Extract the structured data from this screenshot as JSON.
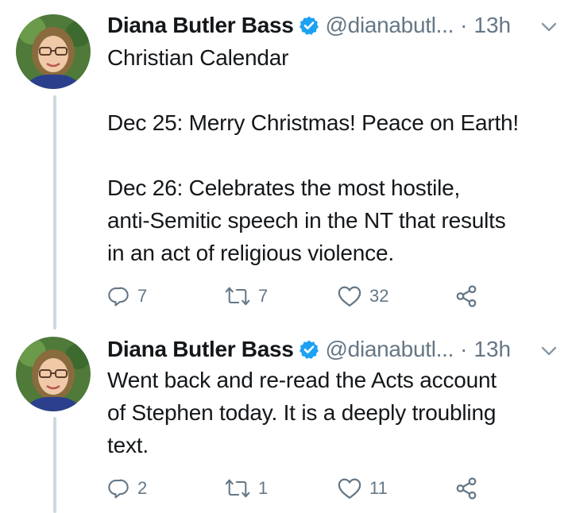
{
  "tweets": [
    {
      "author_name": "Diana Butler Bass",
      "handle": "@dianabutl...",
      "separator": "·",
      "time": "13h",
      "text_lines": [
        "Christian Calendar",
        "",
        "Dec 25: Merry Christmas! Peace on Earth!",
        "",
        "Dec 26: Celebrates the most hostile,",
        "anti-Semitic speech in the NT that results",
        "in an act of religious violence."
      ],
      "replies": "7",
      "retweets": "7",
      "likes": "32"
    },
    {
      "author_name": "Diana Butler Bass",
      "handle": "@dianabutl...",
      "separator": "·",
      "time": "13h",
      "text_lines": [
        "Went back and re-read the Acts account",
        "of Stephen today. It is a deeply troubling",
        "text."
      ],
      "replies": "2",
      "retweets": "1",
      "likes": "11"
    }
  ],
  "colors": {
    "text_primary": "#14171a",
    "text_secondary": "#657786",
    "verified_blue": "#1da1f2",
    "thread_line": "#cfd9de"
  },
  "icons": {
    "reply": "reply-icon",
    "retweet": "retweet-icon",
    "like": "heart-icon",
    "share": "share-icon",
    "verified": "verified-badge-icon",
    "menu": "chevron-down-icon"
  }
}
